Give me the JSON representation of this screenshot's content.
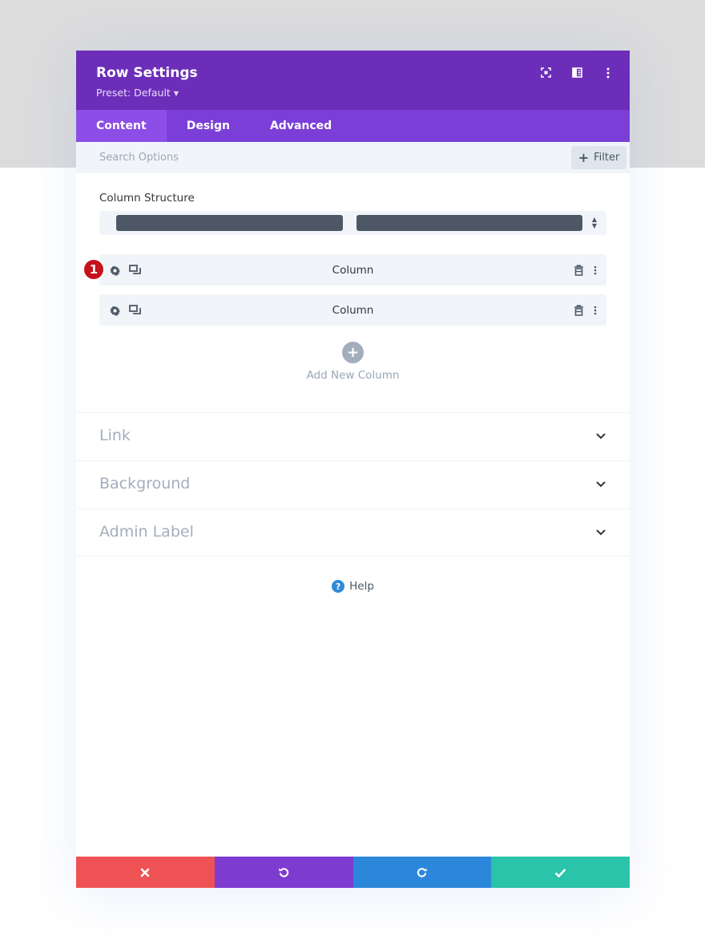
{
  "header": {
    "title": "Row Settings",
    "preset_label": "Preset: Default",
    "icons": [
      "fullscreen-icon",
      "sidebar-toggle-icon",
      "more-vertical-icon"
    ]
  },
  "tabs": [
    {
      "label": "Content",
      "active": true
    },
    {
      "label": "Design",
      "active": false
    },
    {
      "label": "Advanced",
      "active": false
    }
  ],
  "search": {
    "placeholder": "Search Options",
    "filter_label": "Filter"
  },
  "column_structure": {
    "label": "Column Structure",
    "columns": 2
  },
  "columns": [
    {
      "label": "Column",
      "badge": "1"
    },
    {
      "label": "Column"
    }
  ],
  "add_column": {
    "label": "Add New Column"
  },
  "sections": [
    {
      "label": "Link"
    },
    {
      "label": "Background"
    },
    {
      "label": "Admin Label"
    }
  ],
  "help": {
    "label": "Help"
  },
  "footer": {
    "buttons": [
      {
        "name": "cancel",
        "icon": "close-icon",
        "color": "#ee5254"
      },
      {
        "name": "undo",
        "icon": "undo-icon",
        "color": "#7e3bd0"
      },
      {
        "name": "redo",
        "icon": "redo-icon",
        "color": "#2b87da"
      },
      {
        "name": "save",
        "icon": "checkmark-icon",
        "color": "#29c4a9"
      }
    ]
  },
  "colors": {
    "header": "#6c2eb9",
    "tabs": "#7b3fd8",
    "active_tab": "#8c4ee6",
    "badge": "#c5121c"
  }
}
